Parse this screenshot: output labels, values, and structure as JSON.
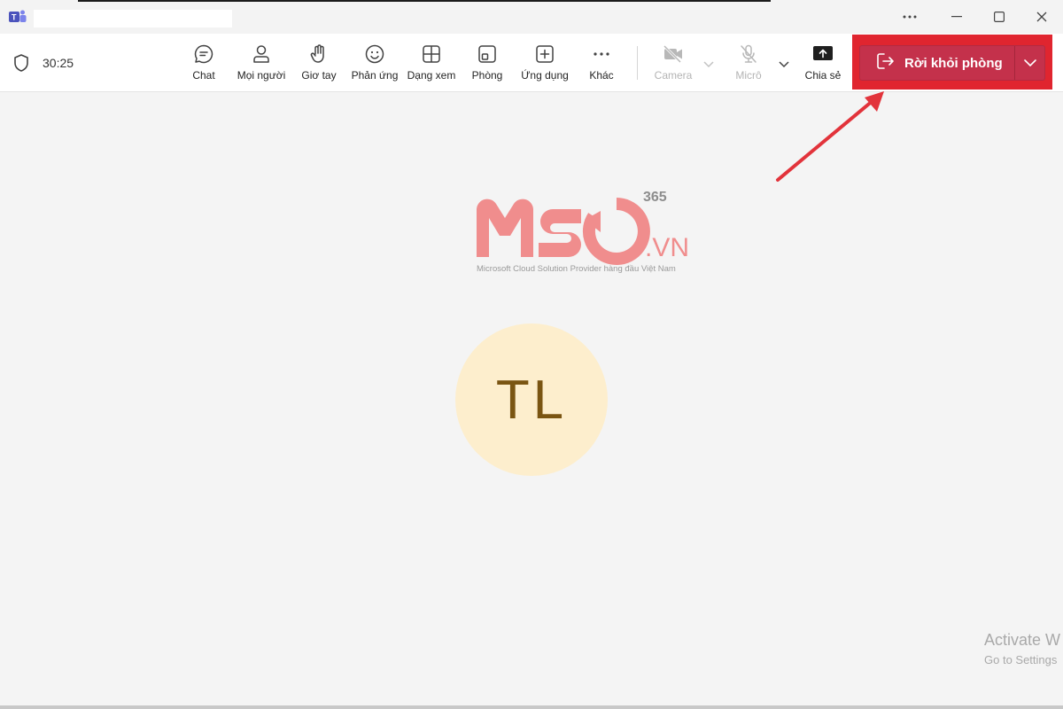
{
  "meeting": {
    "timer": "30:25"
  },
  "toolbar": {
    "chat": "Chat",
    "people": "Mọi người",
    "raise_hand": "Giơ tay",
    "react": "Phản ứng",
    "view": "Dạng xem",
    "rooms": "Phòng",
    "apps": "Ứng dụng",
    "more": "Khác",
    "camera": "Camera",
    "mic": "Micrô",
    "share": "Chia sẻ",
    "leave": "Rời khỏi phòng"
  },
  "participant": {
    "initials": "TL"
  },
  "watermark": {
    "brand_number": "365",
    "brand_suffix": ".VN",
    "tagline": "Microsoft Cloud Solution Provider hàng đầu Việt Nam"
  },
  "activation": {
    "line1": "Activate W",
    "line2": "Go to Settings"
  },
  "colors": {
    "accent_red": "#c4314b",
    "highlight": "#e0252f",
    "avatar_bg": "#fdeecd",
    "avatar_text": "#7a5512",
    "logo_pink": "#f08d8d"
  },
  "icons": [
    "teams-logo-icon",
    "shield-icon",
    "chat-icon",
    "people-icon",
    "raise-hand-icon",
    "react-icon",
    "view-icon",
    "rooms-icon",
    "apps-icon",
    "more-icon",
    "camera-off-icon",
    "mic-off-icon",
    "share-icon",
    "leave-icon",
    "chevron-down-icon"
  ]
}
